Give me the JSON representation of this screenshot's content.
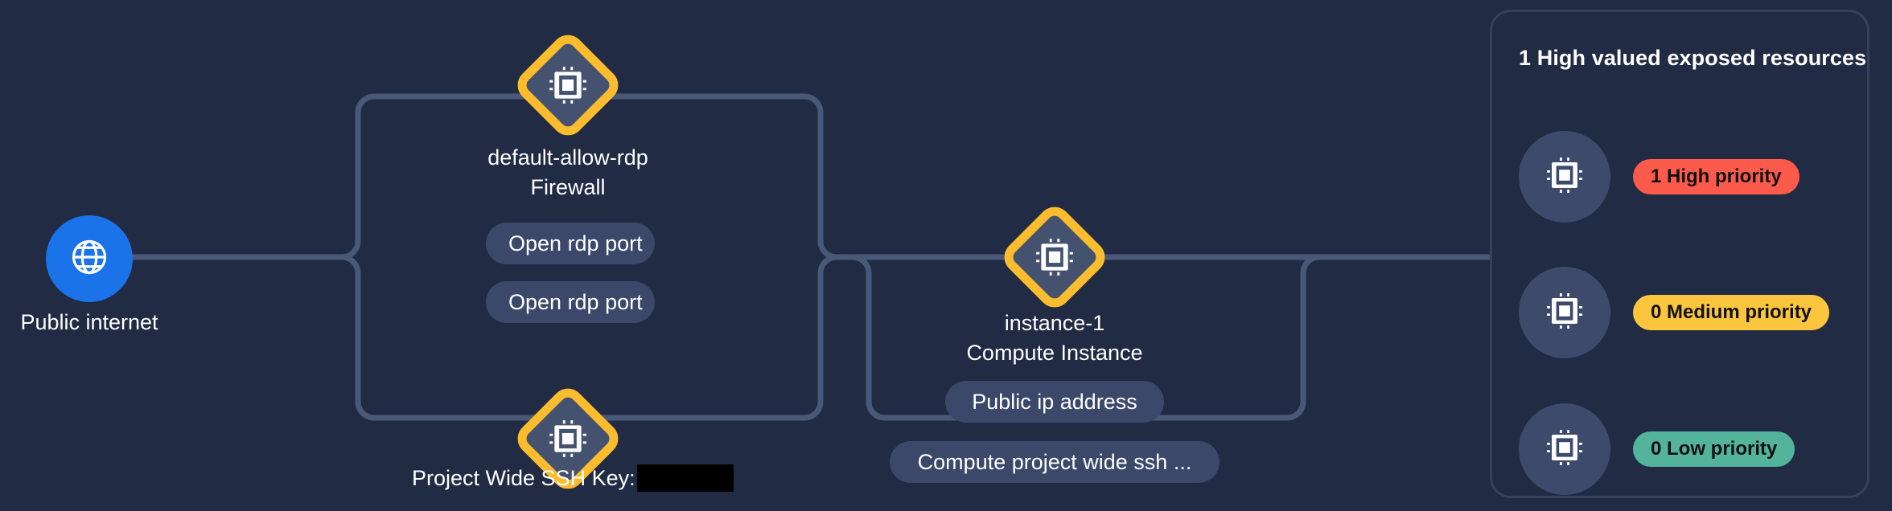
{
  "canvas": {
    "background": "#212b43",
    "edge_color": "#4a5878",
    "node_fill": "#445270",
    "node_border": "#fbbc2e",
    "chip_fill": "#3b486a"
  },
  "internet": {
    "icon": "globe-icon",
    "label": "Public internet",
    "color": "#1a73e8"
  },
  "nodes": [
    {
      "id": "firewall",
      "icon": "cpu-chip-icon",
      "name": "default-allow-rdp",
      "type": "Firewall"
    },
    {
      "id": "instance",
      "icon": "cpu-chip-icon",
      "name": "instance-1",
      "type": "Compute Instance"
    },
    {
      "id": "ssh-key",
      "icon": "cpu-chip-icon",
      "name": "Project Wide SSH Key:",
      "type": ""
    }
  ],
  "chips": {
    "open_rdp_port_1": "Open rdp port",
    "open_rdp_port_2": "Open rdp port",
    "public_ip_address": "Public ip address",
    "compute_project_wide_ssh": "Compute project wide ssh ..."
  },
  "ssh": {
    "label": "Project Wide SSH Key:",
    "value_redacted": ""
  },
  "panel": {
    "title": "1 High valued exposed resources",
    "rows": [
      {
        "icon": "cpu-chip-icon",
        "badge": "1 High priority",
        "color": "#fc5a4b"
      },
      {
        "icon": "cpu-chip-icon",
        "badge": "0 Medium priority",
        "color": "#fbc53d"
      },
      {
        "icon": "cpu-chip-icon",
        "badge": "0 Low priority",
        "color": "#53b49b"
      }
    ]
  }
}
